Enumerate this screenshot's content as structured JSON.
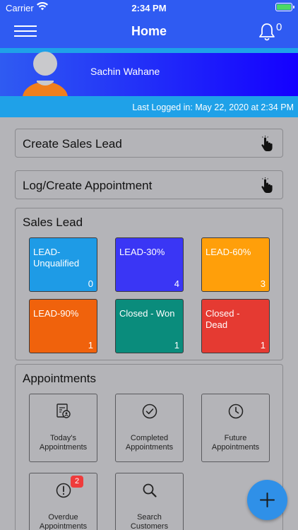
{
  "status_bar": {
    "carrier": "Carrier",
    "time": "2:34 PM"
  },
  "nav": {
    "title": "Home",
    "notification_count": "0"
  },
  "profile": {
    "name": "Sachin Wahane",
    "last_login": "Last Logged in: May 22, 2020 at 2:34 PM"
  },
  "actions": [
    {
      "label": "Create Sales Lead"
    },
    {
      "label": "Log/Create Appointment"
    }
  ],
  "sales_lead": {
    "title": "Sales Lead",
    "tiles": [
      {
        "label": "LEAD-Unqualified",
        "count": "0",
        "color": "#1e9be6"
      },
      {
        "label": "LEAD-30%",
        "count": "4",
        "color": "#3a36f5"
      },
      {
        "label": "LEAD-60%",
        "count": "3",
        "color": "#ff9f0a"
      },
      {
        "label": "LEAD-90%",
        "count": "1",
        "color": "#f0620c"
      },
      {
        "label": "Closed - Won",
        "count": "1",
        "color": "#0a8c7c"
      },
      {
        "label": "Closed - Dead",
        "count": "1",
        "color": "#e53a32"
      }
    ]
  },
  "appointments": {
    "title": "Appointments",
    "items": [
      {
        "label": "Today's Appointments",
        "icon": "calendar-person-icon"
      },
      {
        "label": "Completed Appointments",
        "icon": "check-circle-icon"
      },
      {
        "label": "Future Appointments",
        "icon": "clock-icon"
      },
      {
        "label": "Overdue Appointments",
        "icon": "exclamation-circle-icon",
        "badge": "2"
      },
      {
        "label": "Search Customers",
        "icon": "search-icon"
      }
    ]
  },
  "colors": {
    "nav_blue": "#2f5bf2",
    "banner_deep_blue": "#1400ff",
    "login_bar": "#1fa1e8",
    "fab": "#2f90e8"
  }
}
